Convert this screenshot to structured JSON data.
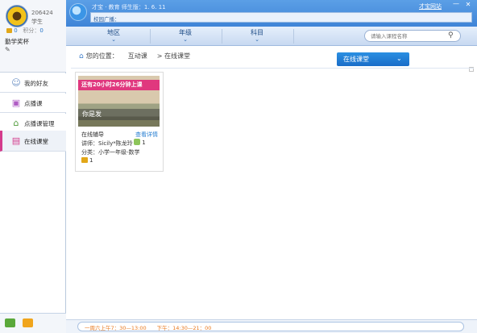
{
  "profile": {
    "user_id": "206424",
    "role": "学生",
    "medal_count": "0",
    "points_label": "积分：",
    "points_value": "0",
    "trophy_label": "勤学奖杯"
  },
  "nav": {
    "items": [
      {
        "label": "我的好友",
        "icon": "friends-icon"
      },
      {
        "label": "点播课",
        "icon": "video-icon"
      },
      {
        "label": "点播课管理",
        "icon": "building-icon"
      },
      {
        "label": "在线课堂",
        "icon": "online-class-icon",
        "active": true
      }
    ]
  },
  "header": {
    "app_title": "才宝 · 教育 师生版：1. 6. 11",
    "campus_label": "校园广播：",
    "site_link": "才宝网站",
    "minimize": "—",
    "close": "✕"
  },
  "filters": {
    "region": "地区",
    "grade": "年级",
    "subject": "科目",
    "search_placeholder": "请输入课程名称"
  },
  "breadcrumb": {
    "prefix": "您的位置：",
    "level1": "互动课",
    "level2": "> 在线课堂"
  },
  "select": {
    "value": "在线课堂"
  },
  "course": {
    "ribbon": "还有20小时26分钟上课",
    "thumb_title": "你是发",
    "name": "在线辅导",
    "detail_link": "查看详情",
    "teacher": "讲师：Sicily*陈龙玲",
    "people": "1",
    "category": "分类：小学一年级-数学",
    "medals": "1"
  },
  "status": {
    "text": "一周六上午7：30—13:00　　下午：14:30—21：00"
  },
  "colors": {
    "header_blue": "#3f84d7",
    "accent_pink": "#e0387e",
    "select_blue": "#1a6dc8",
    "status_orange": "#e8781e"
  }
}
